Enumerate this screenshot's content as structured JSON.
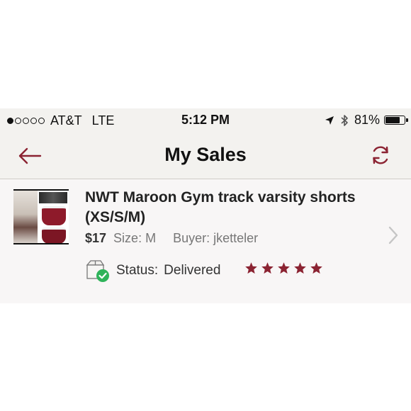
{
  "status_bar": {
    "signal_dots": 5,
    "signal_filled": 1,
    "carrier": "AT&T",
    "network": "LTE",
    "time": "5:12 PM",
    "battery_percent": "81%",
    "battery_level": 0.81,
    "icons": [
      "location-arrow-icon",
      "bluetooth-icon",
      "battery-icon"
    ]
  },
  "nav": {
    "title": "My Sales",
    "back_icon": "back-arrow-icon",
    "refresh_icon": "refresh-icon"
  },
  "sale": {
    "title": "NWT Maroon Gym track varsity shorts (XS/S/M)",
    "price": "$17",
    "size": "Size: M",
    "buyer": "Buyer: jketteler",
    "status_label": "Status:",
    "status_value": "Delivered",
    "rating": 5,
    "rating_max": 5
  },
  "colors": {
    "accent": "#8b2332",
    "status_green": "#2fb35a",
    "header_bg": "#f3f2ef"
  }
}
